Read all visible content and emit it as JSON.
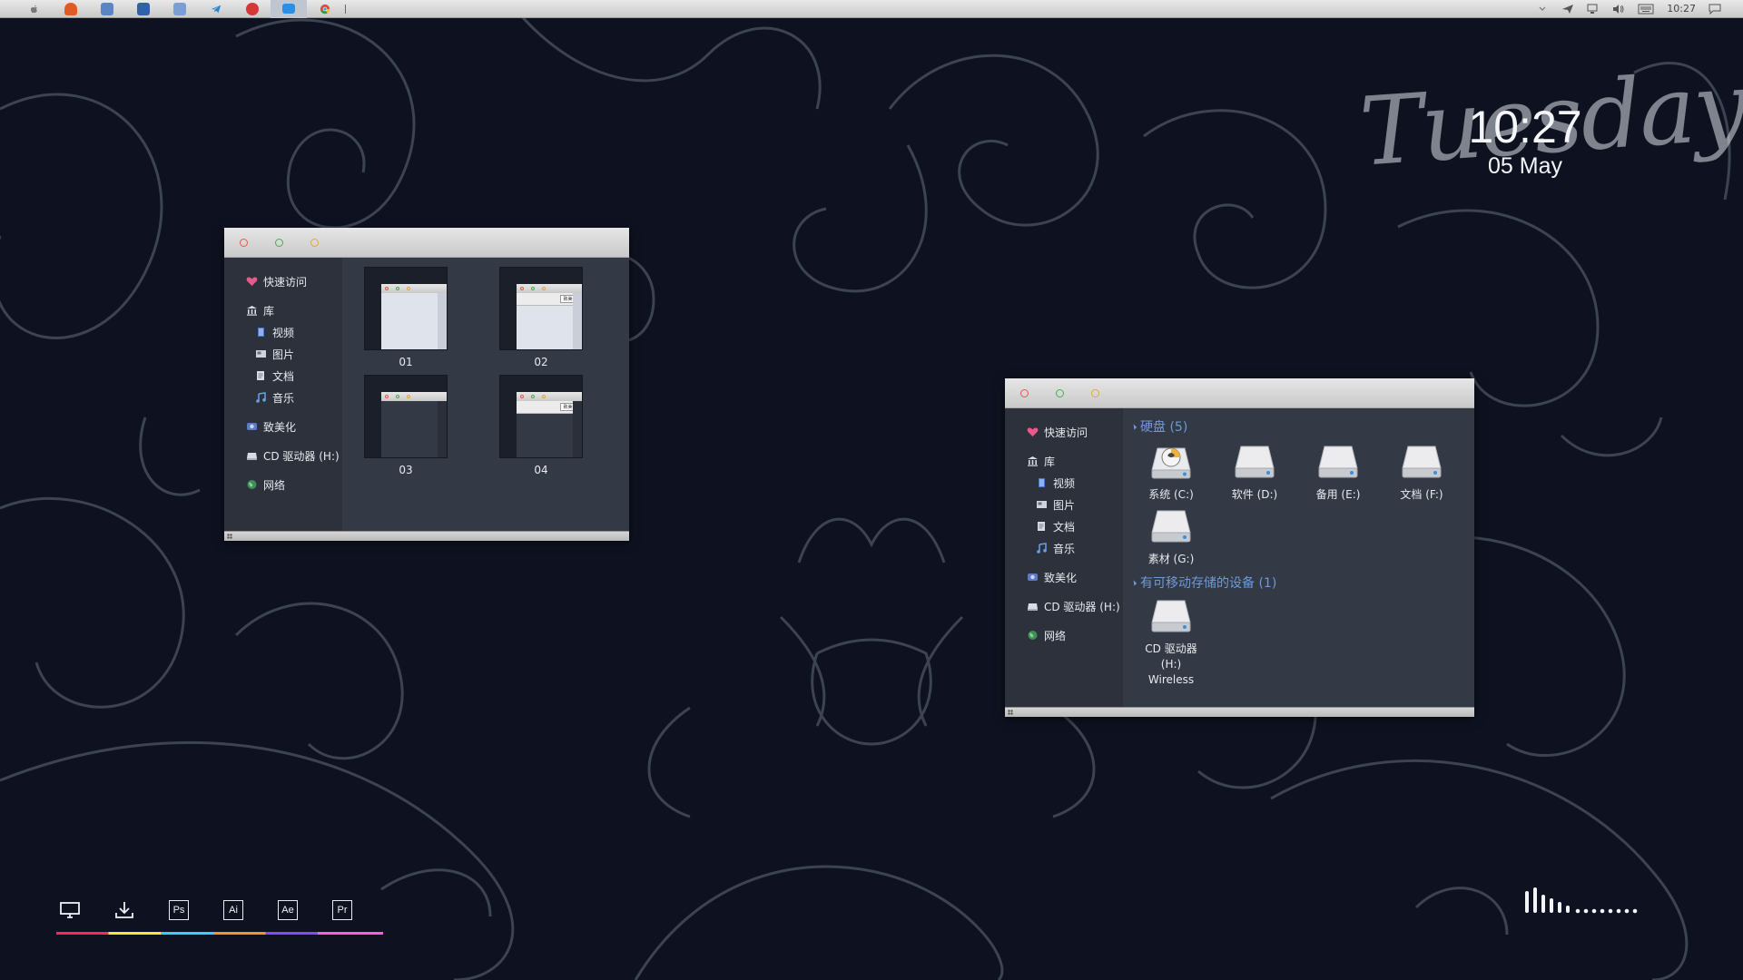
{
  "topbar": {
    "apps": [
      {
        "name": "apple-logo",
        "color": "#7a7a7a"
      },
      {
        "name": "app-orange",
        "color": "#e05a26"
      },
      {
        "name": "app-blue-doc",
        "color": "#3f72b8"
      },
      {
        "name": "app-save",
        "color": "#2f62a6"
      },
      {
        "name": "app-monitor",
        "color": "#5d86c8"
      },
      {
        "name": "app-telegram",
        "color": "#2f86c9"
      },
      {
        "name": "app-red-circle",
        "color": "#d53737"
      },
      {
        "name": "app-folder",
        "color": "#2a8de6"
      },
      {
        "name": "app-chrome",
        "color": "#dd4b39"
      }
    ],
    "clock": "10:27"
  },
  "desktop_clock": {
    "weekday": "Tuesday",
    "time": "10:27",
    "date": "05 May"
  },
  "window_left": {
    "sidebar": {
      "quick_access": "快速访问",
      "library": "库",
      "videos": "视频",
      "pictures": "图片",
      "documents": "文档",
      "music": "音乐",
      "beautify": "致美化",
      "cd_drive": "CD 驱动器 (H:)",
      "network": "网络"
    },
    "thumbs": [
      "01",
      "02",
      "03",
      "04"
    ],
    "mini_pill": "致美化"
  },
  "window_right": {
    "sidebar": {
      "quick_access": "快速访问",
      "library": "库",
      "videos": "视频",
      "pictures": "图片",
      "documents": "文档",
      "music": "音乐",
      "beautify": "致美化",
      "cd_drive": "CD 驱动器 (H:)",
      "network": "网络"
    },
    "section_drives": "硬盘 (5)",
    "drives": [
      "系统 (C:)",
      "软件 (D:)",
      "备用 (E:)",
      "文档 (F:)",
      "素材 (G:)"
    ],
    "section_removable": "有可移动存储的设备 (1)",
    "removable": {
      "line1": "CD 驱动器",
      "line2": "(H:)",
      "line3": "Wireless"
    }
  },
  "dock": {
    "items": [
      "desktop-icon",
      "download-icon",
      "Ps",
      "Ai",
      "Ae",
      "Pr"
    ]
  },
  "colors": {
    "accent": "#6f9ad4",
    "window_body": "#333945",
    "sidebar": "#2c313c",
    "wallpaper": "#0e1220"
  }
}
